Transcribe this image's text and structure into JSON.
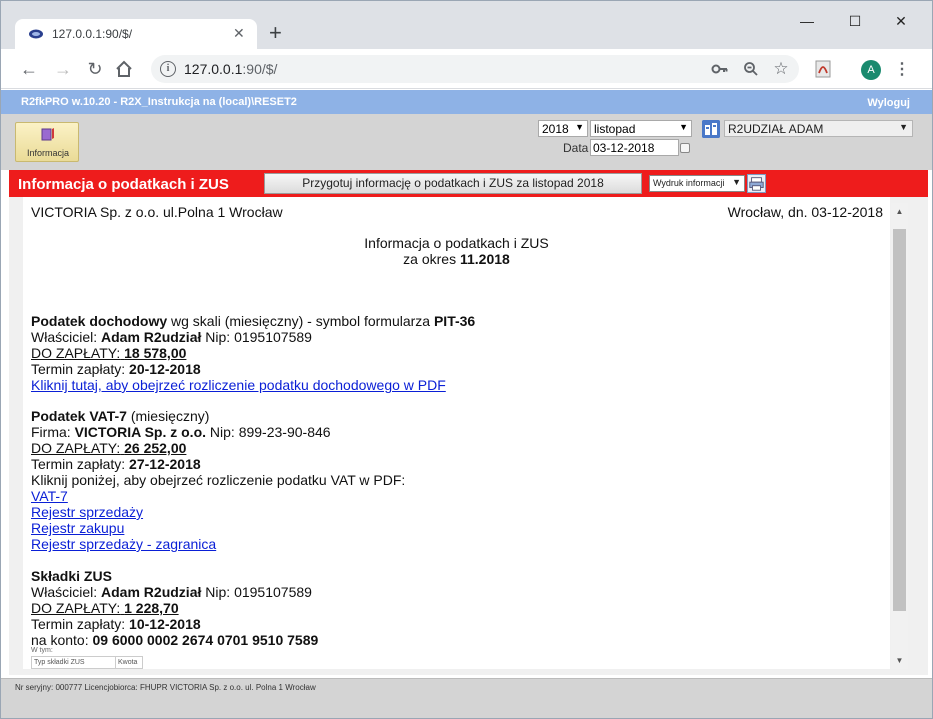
{
  "browser": {
    "tab_title": "127.0.0.1:90/$/",
    "url_host": "127.0.0.1",
    "url_rest": ":90/$/",
    "avatar_letter": "A"
  },
  "app": {
    "title": "R2fkPRO w.10.20 - R2X_Instrukcja na (local)\\RESET2",
    "logout_label": "Wyloguj",
    "info_button_label": "Informacja",
    "year": "2018",
    "month": "listopad",
    "date_label": "Data",
    "date_value": "03-12-2018",
    "department": "R2UDZIAŁ ADAM"
  },
  "section": {
    "title": "Informacja o podatkach i ZUS",
    "prepare_button": "Przygotuj informację o podatkach i ZUS za listopad 2018",
    "print_select": "Wydruk informacji"
  },
  "document": {
    "company": "VICTORIA Sp. z o.o. ul.Polna 1 Wrocław",
    "place_date": "Wrocław, dn. 03-12-2018",
    "heading": "Informacja o podatkach i ZUS",
    "period_prefix": "za okres",
    "period": "11.2018",
    "pit": {
      "title": "Podatek dochodowy",
      "desc": "wg skali (miesięczny) - symbol formularza",
      "form": "PIT-36",
      "owner_label": "Właściciel:",
      "owner": "Adam R2udział",
      "nip_label": "Nip:",
      "nip": "0195107589",
      "pay_label": "DO ZAPŁATY:",
      "amount": "18 578,00",
      "due_label": "Termin zapłaty:",
      "due": "20-12-2018",
      "pdf_link": "Kliknij tutaj, aby obejrzeć rozliczenie podatku dochodowego w PDF"
    },
    "vat": {
      "title": "Podatek VAT-7",
      "desc": "(miesięczny)",
      "firm_label": "Firma:",
      "firm": "VICTORIA Sp. z o.o.",
      "nip_label": "Nip:",
      "nip": "899-23-90-846",
      "pay_label": "DO ZAPŁATY:",
      "amount": "26 252,00",
      "due_label": "Termin zapłaty:",
      "due": "27-12-2018",
      "hint": "Kliknij poniżej, aby obejrzeć rozliczenie podatku VAT w PDF:",
      "links": [
        "VAT-7",
        "Rejestr sprzedaży",
        "Rejestr zakupu",
        "Rejestr sprzedaży - zagranica"
      ]
    },
    "zus": {
      "title": "Składki ZUS",
      "owner_label": "Właściciel:",
      "owner": "Adam R2udział",
      "nip_label": "Nip:",
      "nip": "0195107589",
      "pay_label": "DO ZAPŁATY:",
      "amount": "1 228,70",
      "due_label": "Termin zapłaty:",
      "due": "10-12-2018",
      "account_label": "na konto:",
      "account": "09 6000 0002 2674 0701 9510 7589",
      "wtym": "W tym:",
      "col_type": "Typ składki ZUS",
      "col_amount": "Kwota"
    }
  },
  "status": {
    "text": "Nr seryjny: 000777 Licencjobiorca: FHUPR VICTORIA Sp. z o.o. ul. Polna 1 Wrocław"
  }
}
